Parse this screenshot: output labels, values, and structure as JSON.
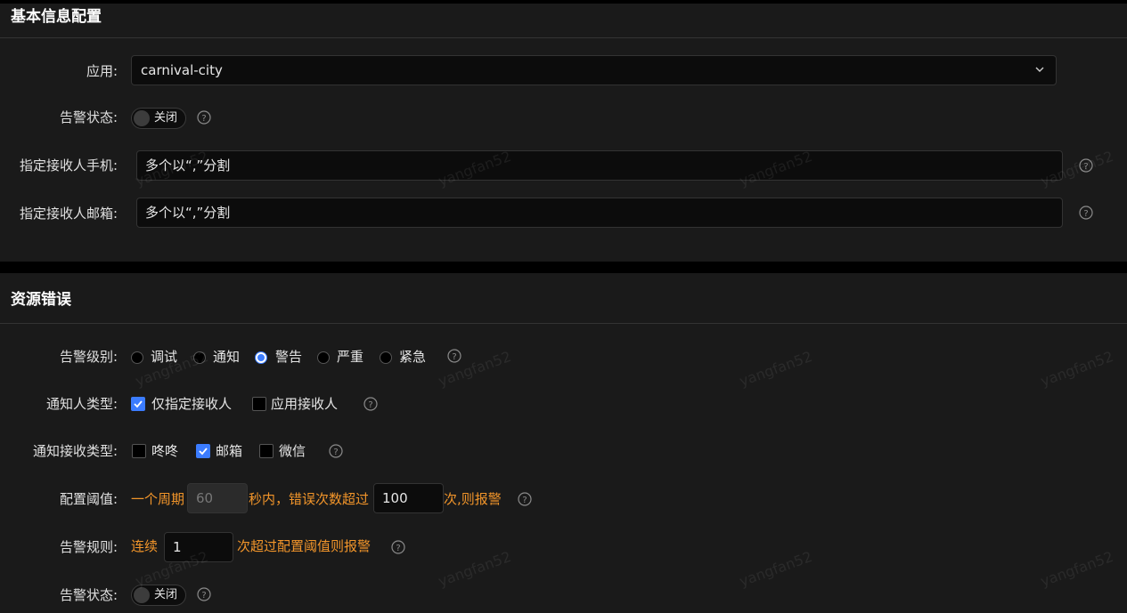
{
  "basic": {
    "title": "基本信息配置",
    "app_label": "应用:",
    "app_value": "carnival-city",
    "status_label": "告警状态:",
    "status_text": "关闭",
    "phone_label": "指定接收人手机:",
    "phone_placeholder": "多个以“,”分割",
    "email_label": "指定接收人邮箱:",
    "email_placeholder": "多个以“,”分割"
  },
  "resource": {
    "title": "资源错误",
    "level_label": "告警级别:",
    "levels": [
      "调试",
      "通知",
      "警告",
      "严重",
      "紧急"
    ],
    "selected_level": "警告",
    "notify_type_label": "通知人类型:",
    "notify_types": [
      {
        "label": "仅指定接收人",
        "checked": true
      },
      {
        "label": "应用接收人",
        "checked": false
      }
    ],
    "channel_label": "通知接收类型:",
    "channels": [
      {
        "label": "咚咚",
        "checked": false
      },
      {
        "label": "邮箱",
        "checked": true
      },
      {
        "label": "微信",
        "checked": false
      }
    ],
    "threshold_label": "配置阈值:",
    "threshold_prefix": "一个周期",
    "period_value": "60",
    "threshold_middle": "秒内，错误次数超过",
    "count_value": "100",
    "threshold_suffix": "次,则报警",
    "rule_label": "告警规则:",
    "rule_prefix": "连续",
    "rule_value": "1",
    "rule_suffix": "次超过配置阈值则报警",
    "status_label": "告警状态:",
    "status_text": "关闭"
  },
  "watermark": "yangfan52",
  "colors": {
    "accent": "#3b7cff",
    "warning_text": "#f2952a",
    "background": "#1a1a1a"
  }
}
